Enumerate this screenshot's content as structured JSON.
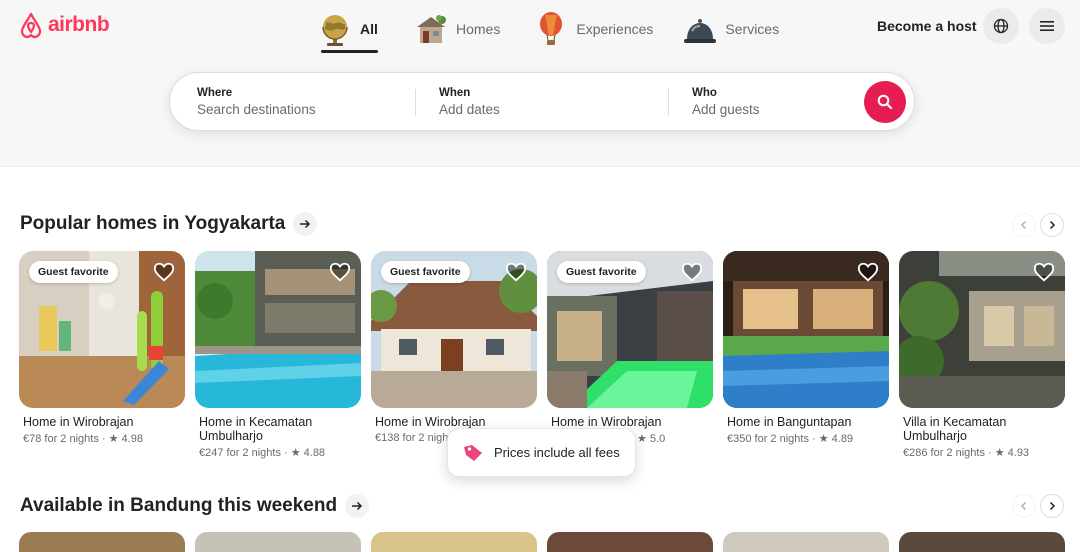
{
  "header": {
    "logo_text": "airbnb",
    "nav": [
      {
        "label": "All",
        "icon": "globe-icon",
        "active": true
      },
      {
        "label": "Homes",
        "icon": "house-icon",
        "active": false
      },
      {
        "label": "Experiences",
        "icon": "hot-air-balloon-icon",
        "active": false
      },
      {
        "label": "Services",
        "icon": "service-bell-icon",
        "active": false
      }
    ],
    "become_host": "Become a host"
  },
  "search": {
    "where_label": "Where",
    "where_placeholder": "Search destinations",
    "when_label": "When",
    "when_placeholder": "Add dates",
    "who_label": "Who",
    "who_placeholder": "Add guests"
  },
  "sections": [
    {
      "title": "Popular homes in Yogyakarta"
    },
    {
      "title": "Available in Bandung this weekend"
    }
  ],
  "listings": [
    {
      "title": "Home in Wirobrajan",
      "meta": "€78 for 2 nights · ★ 4.98",
      "badge": "Guest favorite"
    },
    {
      "title": "Home in Kecamatan Umbulharjo",
      "meta": "€247 for 2 nights · ★ 4.88",
      "badge": ""
    },
    {
      "title": "Home in Wirobrajan",
      "meta": "€138 for 2 nights",
      "badge": "Guest favorite"
    },
    {
      "title": "Home in Wirobrajan",
      "meta": "★ 5.0",
      "badge": "Guest favorite"
    },
    {
      "title": "Home in Banguntapan",
      "meta": "€350 for 2 nights · ★ 4.89",
      "badge": ""
    },
    {
      "title": "Villa in Kecamatan Umbulharjo",
      "meta": "€286 for 2 nights · ★ 4.93",
      "badge": ""
    }
  ],
  "toast": {
    "text": "Prices include all fees"
  },
  "colors": {
    "brand": "#ff385c",
    "search_button": "#e51d53"
  }
}
